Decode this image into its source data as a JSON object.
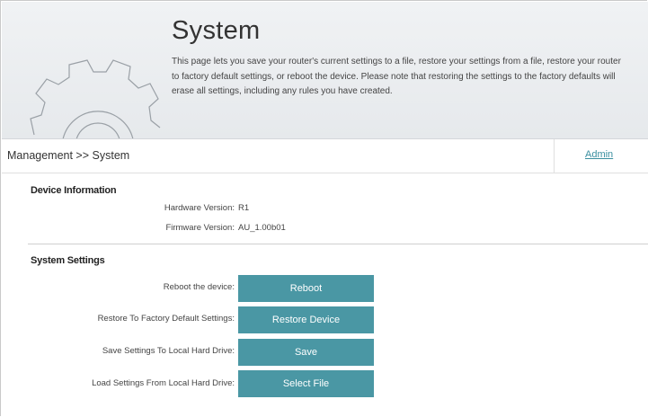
{
  "header": {
    "title": "System",
    "description_lines": [
      "This page lets you save your router's current settings to a file, restore your settings from a file, restore your router",
      "to factory default settings, or reboot the device. Please note that restoring the settings to the factory defaults will",
      "erase all settings, including any rules you have created."
    ],
    "icon": "gear-icon"
  },
  "breadcrumb": {
    "text": "Management >> System",
    "admin_link": "Admin"
  },
  "device_info": {
    "section_title": "Device Information",
    "hardware_label": "Hardware Version:",
    "hardware_value": "R1",
    "firmware_label": "Firmware Version:",
    "firmware_value": "AU_1.00b01"
  },
  "system_settings": {
    "section_title": "System Settings",
    "rows": [
      {
        "label": "Reboot the device:",
        "button": "Reboot"
      },
      {
        "label": "Restore To Factory Default Settings:",
        "button": "Restore Device"
      },
      {
        "label": "Save Settings To Local Hard Drive:",
        "button": "Save"
      },
      {
        "label": "Load Settings From Local Hard Drive:",
        "button": "Select File"
      }
    ]
  },
  "colors": {
    "accent": "#4a97a4",
    "link": "#3a8fa0",
    "header_bg": "#eceef0"
  }
}
